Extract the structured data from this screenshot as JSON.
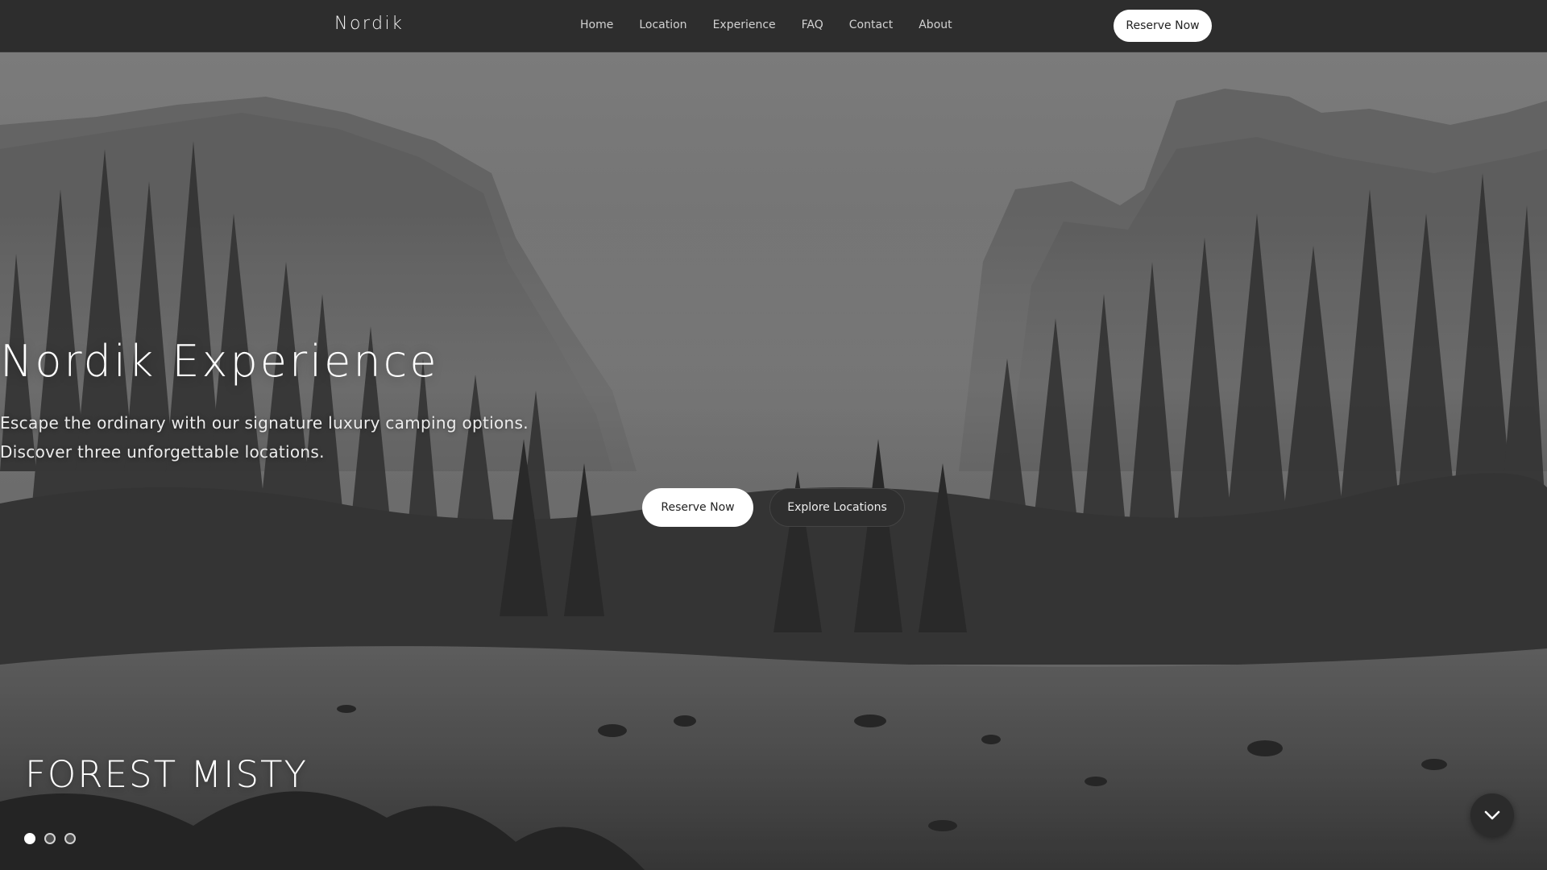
{
  "brand": {
    "name": "Nordik"
  },
  "nav": {
    "links": [
      {
        "label": "Home"
      },
      {
        "label": "Location"
      },
      {
        "label": "Experience"
      },
      {
        "label": "FAQ"
      },
      {
        "label": "Contact"
      },
      {
        "label": "About"
      }
    ],
    "cta_label": "Reserve Now"
  },
  "hero": {
    "title": "Nordik Experience",
    "subtitle_line1": "Escape the ordinary with our signature luxury camping options.",
    "subtitle_line2": "Discover three unforgettable locations.",
    "primary_button": "Reserve Now",
    "secondary_button": "Explore Locations",
    "slide_label": "FOREST MISTY",
    "slides": {
      "count": 3,
      "active_index": 0
    }
  },
  "colors": {
    "navbar_bg": "#2d2d2d",
    "button_light": "#ffffff",
    "button_dark": "#2f2f2f",
    "text_light": "#ffffff"
  },
  "icons": {
    "scroll": "chevron-down-icon"
  }
}
